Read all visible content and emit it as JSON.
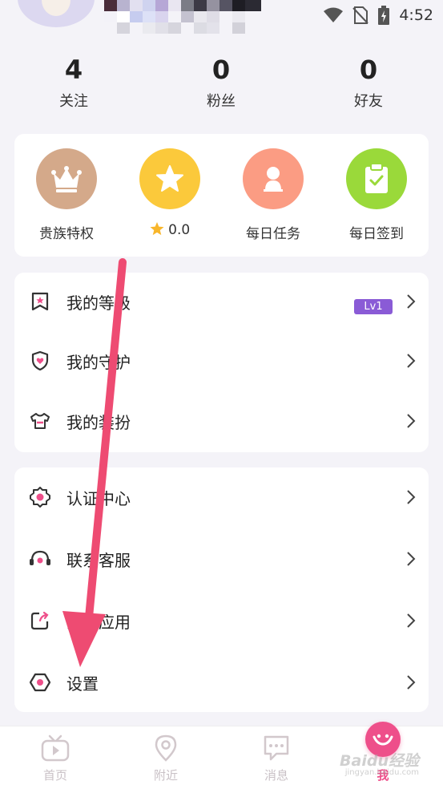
{
  "status_bar": {
    "time": "4:52"
  },
  "stats": [
    {
      "value": "4",
      "label": "关注"
    },
    {
      "value": "0",
      "label": "粉丝"
    },
    {
      "value": "0",
      "label": "好友"
    }
  ],
  "quick_actions": [
    {
      "label": "贵族特权",
      "icon": "crown-icon",
      "color": "#d4a98a"
    },
    {
      "label": "0.0",
      "icon": "star-icon",
      "color": "#fbc93b"
    },
    {
      "label": "每日任务",
      "icon": "person-icon",
      "color": "#fb9c83"
    },
    {
      "label": "每日签到",
      "icon": "clipboard-check-icon",
      "color": "#9ad93a"
    }
  ],
  "menu_group_1": [
    {
      "label": "我的等级",
      "icon": "bookmark-star-icon",
      "badge": "Lv1"
    },
    {
      "label": "我的守护",
      "icon": "shield-heart-icon"
    },
    {
      "label": "我的装扮",
      "icon": "tshirt-icon"
    }
  ],
  "menu_group_2": [
    {
      "label": "认证中心",
      "icon": "badge-gear-icon"
    },
    {
      "label": "联系客服",
      "icon": "headset-icon"
    },
    {
      "label": "分享应用",
      "icon": "share-icon"
    },
    {
      "label": "设置",
      "icon": "hexagon-settings-icon"
    }
  ],
  "bottom_nav": [
    {
      "label": "首页",
      "icon": "tv-play-icon"
    },
    {
      "label": "附近",
      "icon": "location-pin-icon"
    },
    {
      "label": "消息",
      "icon": "chat-bubble-icon"
    },
    {
      "label": "我",
      "icon": "me-icon",
      "active": true
    }
  ],
  "watermark": {
    "text": "Baidu经验",
    "sub": "jingyan.baidu.com"
  },
  "colors": {
    "accent": "#ee4f8a",
    "level_badge": "#8a5bd6",
    "arrow": "#ee4b72"
  }
}
